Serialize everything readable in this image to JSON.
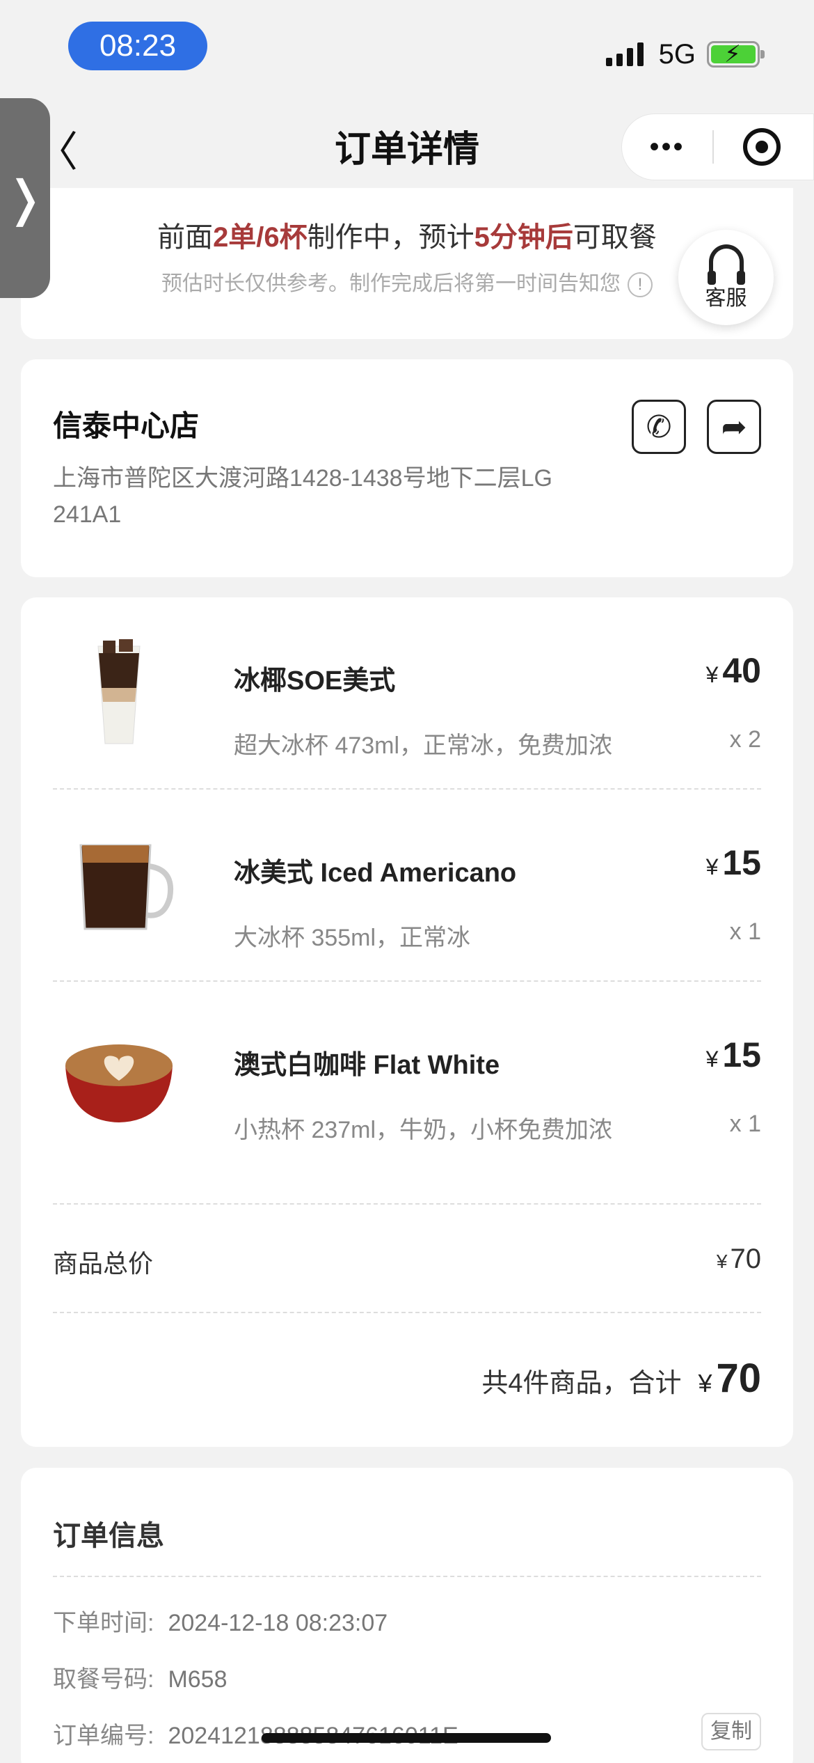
{
  "status_bar": {
    "time": "08:23",
    "network": "5G"
  },
  "nav": {
    "title": "订单详情",
    "back": "〈",
    "more": "•••"
  },
  "side_tab": {
    "glyph": "❭"
  },
  "progress": {
    "prefix": "前面",
    "queue": "2单/6杯",
    "middle": "制作中，预计",
    "eta": "5分钟后",
    "suffix": "可取餐",
    "note": "预估时长仅供参考。制作完成后将第一时间告知您",
    "info_glyph": "!"
  },
  "customer_service": {
    "label": "客服"
  },
  "store": {
    "name": "信泰中心店",
    "address": "上海市普陀区大渡河路1428-1438号地下二层LG 241A1",
    "phone_icon": "phone-icon",
    "nav_icon": "directions-icon"
  },
  "items": [
    {
      "name": "冰椰SOE美式",
      "options": "超大冰杯 473ml，正常冰，免费加浓",
      "price": "40",
      "qty": "x 2"
    },
    {
      "name": "冰美式 Iced Americano",
      "options": "大冰杯 355ml，正常冰",
      "price": "15",
      "qty": "x 1"
    },
    {
      "name": "澳式白咖啡 Flat White",
      "options": "小热杯 237ml，牛奶，小杯免费加浓",
      "price": "15",
      "qty": "x 1"
    }
  ],
  "currency": "¥",
  "subtotal": {
    "label": "商品总价",
    "value": "70"
  },
  "grand_total": {
    "label": "共4件商品，合计",
    "value": "70"
  },
  "order_info": {
    "title": "订单信息",
    "order_time_label": "下单时间:",
    "order_time": "2024-12-18 08:23:07",
    "pickup_label": "取餐号码:",
    "pickup_code": "M658",
    "order_no_label": "订单编号:",
    "order_no": "20241218888584761601​1E",
    "copy_label": "复制"
  }
}
